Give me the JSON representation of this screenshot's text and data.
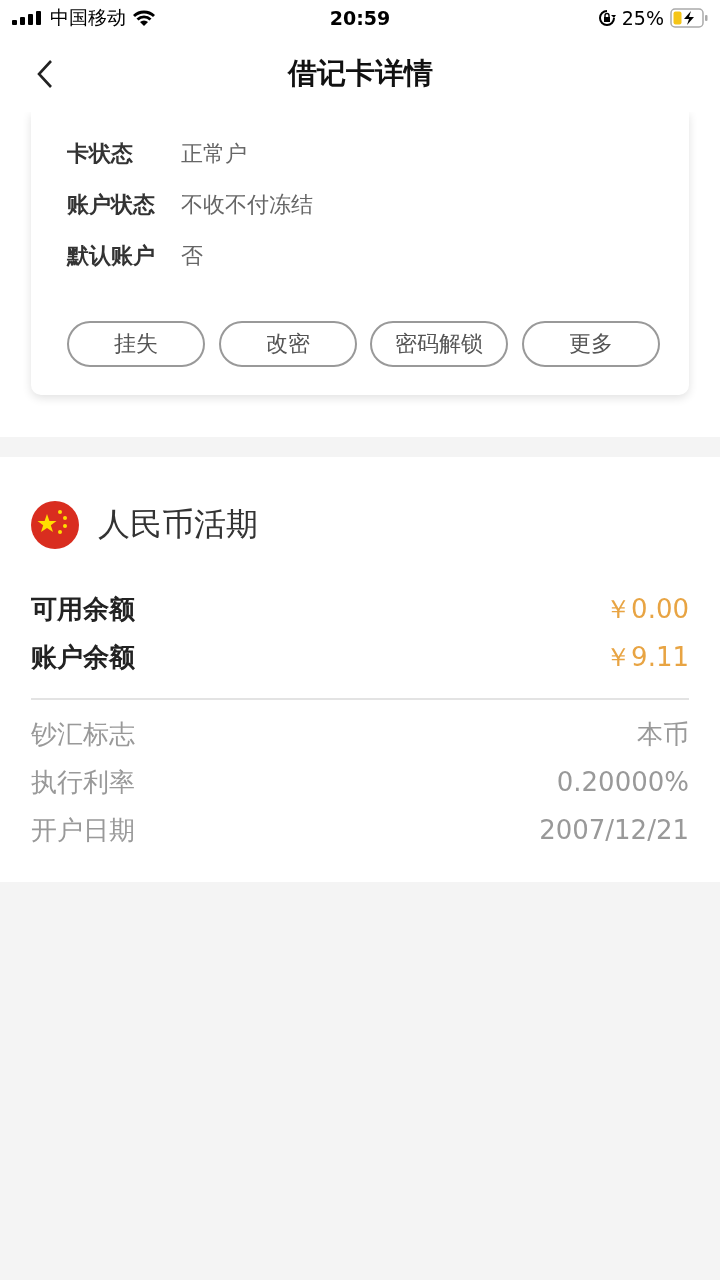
{
  "status_bar": {
    "carrier": "中国移动",
    "time": "20:59",
    "battery": "25%"
  },
  "nav": {
    "title": "借记卡详情"
  },
  "card_info": [
    {
      "label": "卡状态",
      "value": "正常户"
    },
    {
      "label": "账户状态",
      "value": "不收不付冻结"
    },
    {
      "label": "默认账户",
      "value": "否"
    }
  ],
  "card_actions": [
    "挂失",
    "改密",
    "密码解锁",
    "更多"
  ],
  "account": {
    "title": "人民币活期",
    "balances": [
      {
        "label": "可用余额",
        "value": "￥0.00"
      },
      {
        "label": "账户余额",
        "value": "￥9.11"
      }
    ],
    "details": [
      {
        "label": "钞汇标志",
        "value": "本币"
      },
      {
        "label": "执行利率",
        "value": "0.20000%"
      },
      {
        "label": "开户日期",
        "value": "2007/12/21"
      }
    ]
  }
}
